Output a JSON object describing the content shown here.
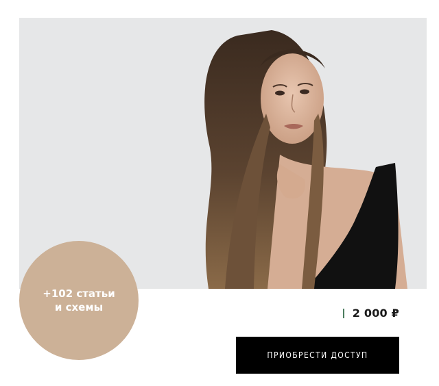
{
  "product": {
    "badge_text": "+102 статьи\nи схемы",
    "price": "2 000 ₽",
    "buy_button_label": "ПРИОБРЕСТИ ДОСТУП"
  },
  "colors": {
    "badge_bg": "#ccb197",
    "price_accent": "#4c7d5e",
    "button_bg": "#000000",
    "photo_bg": "#e6e7e8"
  }
}
